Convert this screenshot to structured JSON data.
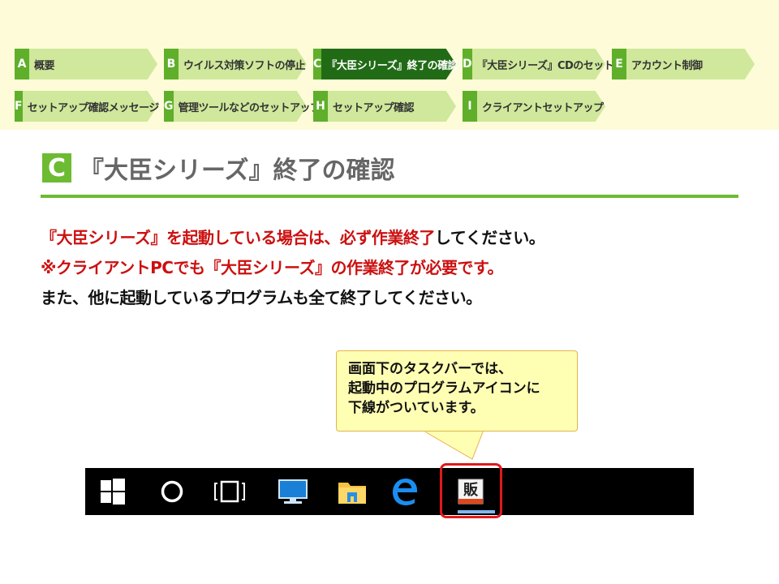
{
  "nav": {
    "row1": [
      {
        "letter": "A",
        "label": "概要"
      },
      {
        "letter": "B",
        "label": "ウイルス対策ソフトの停止"
      },
      {
        "letter": "C",
        "label": "『大臣シリーズ』終了の確認",
        "active": true
      },
      {
        "letter": "D",
        "label": "『大臣シリーズ』CDのセット"
      },
      {
        "letter": "E",
        "label": "アカウント制御"
      }
    ],
    "row2": [
      {
        "letter": "F",
        "label": "セットアップ確認メッセージ"
      },
      {
        "letter": "G",
        "label": "管理ツールなどのセットアップ"
      },
      {
        "letter": "H",
        "label": "セットアップ確認"
      },
      {
        "letter": "I",
        "label": "クライアントセットアップ"
      }
    ]
  },
  "section": {
    "letter": "C",
    "title": "『大臣シリーズ』終了の確認"
  },
  "body": {
    "line1_red": "『大臣シリーズ』を起動している場合は、必ず作業終了",
    "line1_black": "してください。",
    "line2": "※クライアントPCでも『大臣シリーズ』の作業終了が必要です。",
    "line3": "また、他に起動しているプログラムも全て終了してください。"
  },
  "callout": {
    "line1": "画面下のタスクバーでは、",
    "line2": "起動中のプログラムアイコンに",
    "line3": "下線がついています。"
  },
  "taskbar": {
    "icons": [
      "windows-start-icon",
      "cortana-icon",
      "task-view-icon",
      "computer-icon",
      "file-explorer-icon",
      "edge-icon",
      "daijin-app-icon"
    ],
    "app_glyph": "販"
  },
  "colors": {
    "accent": "#6dbb32",
    "active_nav": "#226b16",
    "highlight": "#e0191a",
    "emphasis": "#cc1010"
  }
}
